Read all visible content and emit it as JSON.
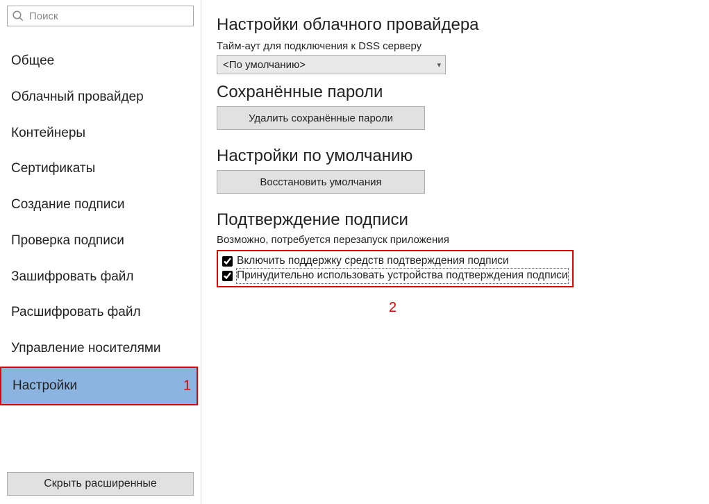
{
  "search": {
    "placeholder": "Поиск"
  },
  "sidebar": {
    "items": [
      {
        "label": "Общее"
      },
      {
        "label": "Облачный провайдер"
      },
      {
        "label": "Контейнеры"
      },
      {
        "label": "Сертификаты"
      },
      {
        "label": "Создание подписи"
      },
      {
        "label": "Проверка подписи"
      },
      {
        "label": "Зашифровать файл"
      },
      {
        "label": "Расшифровать файл"
      },
      {
        "label": "Управление носителями"
      },
      {
        "label": "Настройки"
      }
    ],
    "selected_index": 9,
    "collapse_button": "Скрыть расширенные"
  },
  "annotations": {
    "marker1": "1",
    "marker2": "2"
  },
  "content": {
    "cloud_provider": {
      "title": "Настройки облачного провайдера",
      "timeout_label": "Тайм-аут для подключения к DSS серверу",
      "timeout_value": "<По умолчанию>"
    },
    "saved_passwords": {
      "title": "Сохранённые пароли",
      "delete_button": "Удалить сохранённые пароли"
    },
    "defaults": {
      "title": "Настройки по умолчанию",
      "restore_button": "Восстановить умолчания"
    },
    "sign_confirmation": {
      "title": "Подтверждение подписи",
      "note": "Возможно, потребуется перезапуск приложения",
      "cb1_label": "Включить поддержку средств подтверждения подписи",
      "cb2_label": "Принудительно использовать устройства подтверждения подписи"
    }
  }
}
